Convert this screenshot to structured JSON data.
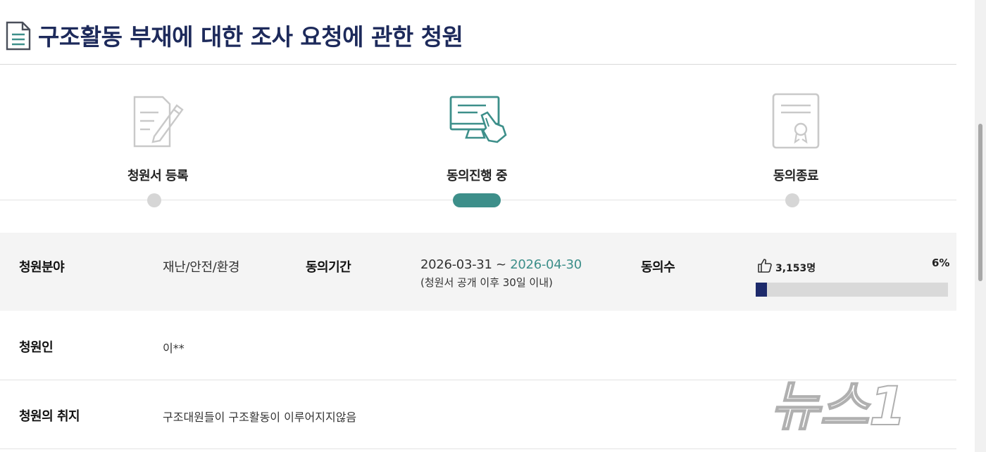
{
  "title": "구조활동 부재에 대한 조사 요청에 관한 청원",
  "steps": [
    {
      "label": "청원서 등록",
      "icon": "document-pen-icon",
      "state": "inactive"
    },
    {
      "label": "동의진행 중",
      "icon": "monitor-click-icon",
      "state": "active"
    },
    {
      "label": "동의종료",
      "icon": "certificate-icon",
      "state": "inactive"
    }
  ],
  "info": {
    "field_label": "청원분야",
    "field_value": "재난/안전/환경",
    "period_label": "동의기간",
    "period_start": "2026-03-31",
    "period_sep": " ~ ",
    "period_end": "2026-04-30",
    "period_note": "(청원서 공개 이후 30일 이내)",
    "agree_label": "동의수",
    "agree_count": "3,153명",
    "agree_percent": "6%",
    "agree_progress": 0.06
  },
  "petitioner": {
    "label": "청원인",
    "value": "이**"
  },
  "purpose": {
    "label": "청원의 취지",
    "value": "구조대원들이 구조활동이 이루어지지않음"
  },
  "watermark_text": "뉴스1",
  "colors": {
    "title": "#1d2a5b",
    "accent": "#3d8f8a",
    "progress": "#1d2a6b"
  }
}
